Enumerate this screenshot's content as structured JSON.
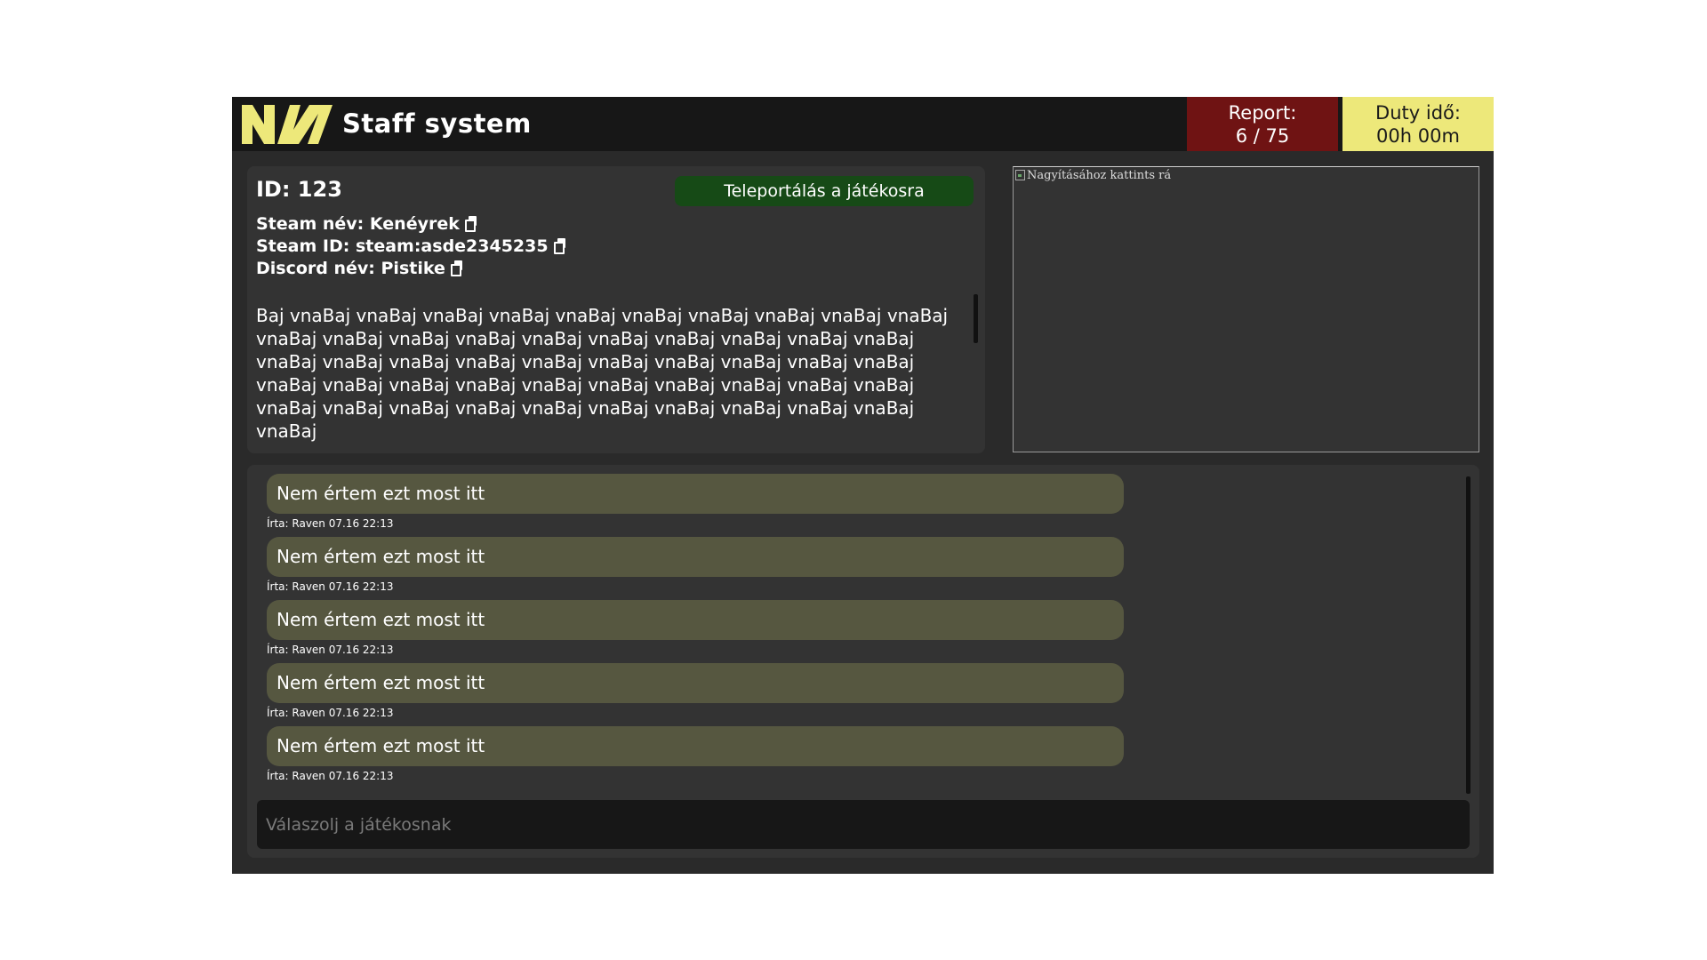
{
  "header": {
    "title": "Staff system",
    "logo_text": "NV",
    "logo_color": "#ede87a",
    "report": {
      "label": "Report:",
      "value": "6 / 75"
    },
    "duty": {
      "label": "Duty idő:",
      "value": "00h 00m"
    }
  },
  "player": {
    "id": "ID: 123",
    "teleport_label": "Teleportálás a játékosra",
    "steam_name": "Steam név: Kenéyrek",
    "steam_id": "Steam ID: steam:asde2345235",
    "discord_name": "Discord név: Pistike",
    "report_text": "Baj vnaBaj vnaBaj vnaBaj vnaBaj vnaBaj vnaBaj vnaBaj vnaBaj vnaBaj vnaBaj vnaBaj vnaBaj vnaBaj vnaBaj vnaBaj vnaBaj vnaBaj vnaBaj vnaBaj vnaBaj vnaBaj vnaBaj vnaBaj vnaBaj vnaBaj vnaBaj vnaBaj vnaBaj vnaBaj vnaBaj vnaBaj vnaBaj vnaBaj vnaBaj vnaBaj vnaBaj vnaBaj vnaBaj vnaBaj vnaBaj vnaBaj vnaBaj vnaBaj vnaBaj vnaBaj vnaBaj vnaBaj vnaBaj vnaBaj vnaBaj vnaBaj"
  },
  "screenshot": {
    "alt_text": "Nagyításához kattints rá"
  },
  "chat": {
    "messages": [
      {
        "text": "Nem értem ezt most itt",
        "meta": "Írta: Raven 07.16 22:13"
      },
      {
        "text": "Nem értem ezt most itt",
        "meta": "Írta: Raven 07.16 22:13"
      },
      {
        "text": "Nem értem ezt most itt",
        "meta": "Írta: Raven 07.16 22:13"
      },
      {
        "text": "Nem értem ezt most itt",
        "meta": "Írta: Raven 07.16 22:13"
      },
      {
        "text": "Nem értem ezt most itt",
        "meta": "Írta: Raven 07.16 22:13"
      }
    ],
    "reply_placeholder": "Válaszolj a játékosnak",
    "reply_value": ""
  },
  "colors": {
    "background": "#2a2a2a",
    "topbar": "#171717",
    "panel": "#333333",
    "report_badge": "#6f1313",
    "duty_badge": "#ede87a",
    "teleport_button": "#164a16",
    "message_bubble": "#565740"
  }
}
